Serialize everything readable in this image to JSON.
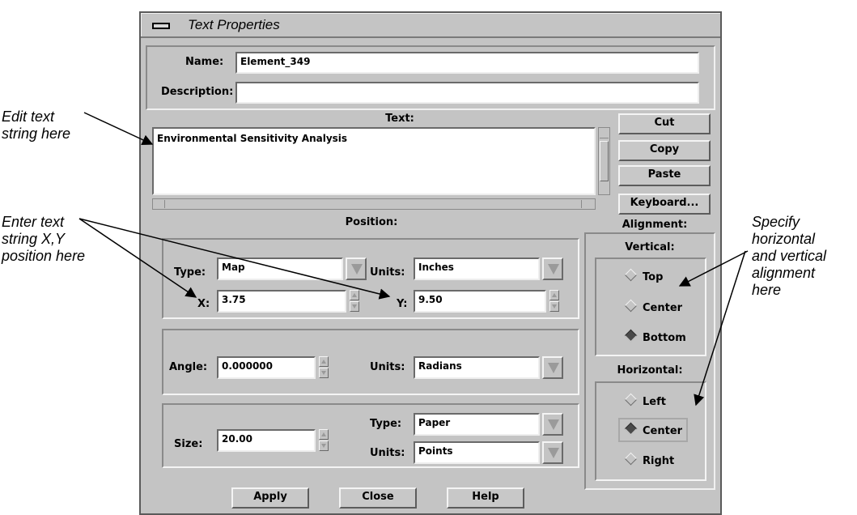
{
  "window": {
    "title": "Text Properties"
  },
  "fields": {
    "name_label": "Name:",
    "name_value": "Element_349",
    "description_label": "Description:",
    "description_value": ""
  },
  "text_section": {
    "label": "Text:",
    "value": "Environmental Sensitivity Analysis"
  },
  "edit_buttons": {
    "cut": "Cut",
    "copy": "Copy",
    "paste": "Paste",
    "keyboard": "Keyboard..."
  },
  "position": {
    "label": "Position:",
    "type_label": "Type:",
    "type_value": "Map",
    "units_label": "Units:",
    "units_value": "Inches",
    "x_label": "X:",
    "x_value": "3.75",
    "y_label": "Y:",
    "y_value": "9.50"
  },
  "angle": {
    "label": "Angle:",
    "value": "0.000000",
    "units_label": "Units:",
    "units_value": "Radians"
  },
  "size": {
    "label": "Size:",
    "value": "20.00",
    "type_label": "Type:",
    "type_value": "Paper",
    "units_label": "Units:",
    "units_value": "Points"
  },
  "alignment": {
    "label": "Alignment:",
    "vertical_label": "Vertical:",
    "vertical_options": [
      "Top",
      "Center",
      "Bottom"
    ],
    "vertical_selected": "Bottom",
    "horizontal_label": "Horizontal:",
    "horizontal_options": [
      "Left",
      "Center",
      "Right"
    ],
    "horizontal_selected": "Center"
  },
  "footer": {
    "apply": "Apply",
    "close": "Close",
    "help": "Help"
  },
  "callouts": {
    "edit_text": "Edit text\nstring here",
    "enter_xy": "Enter text\nstring X,Y\nposition here",
    "alignment": "Specify\nhorizontal\nand vertical\nalignment\nhere"
  }
}
